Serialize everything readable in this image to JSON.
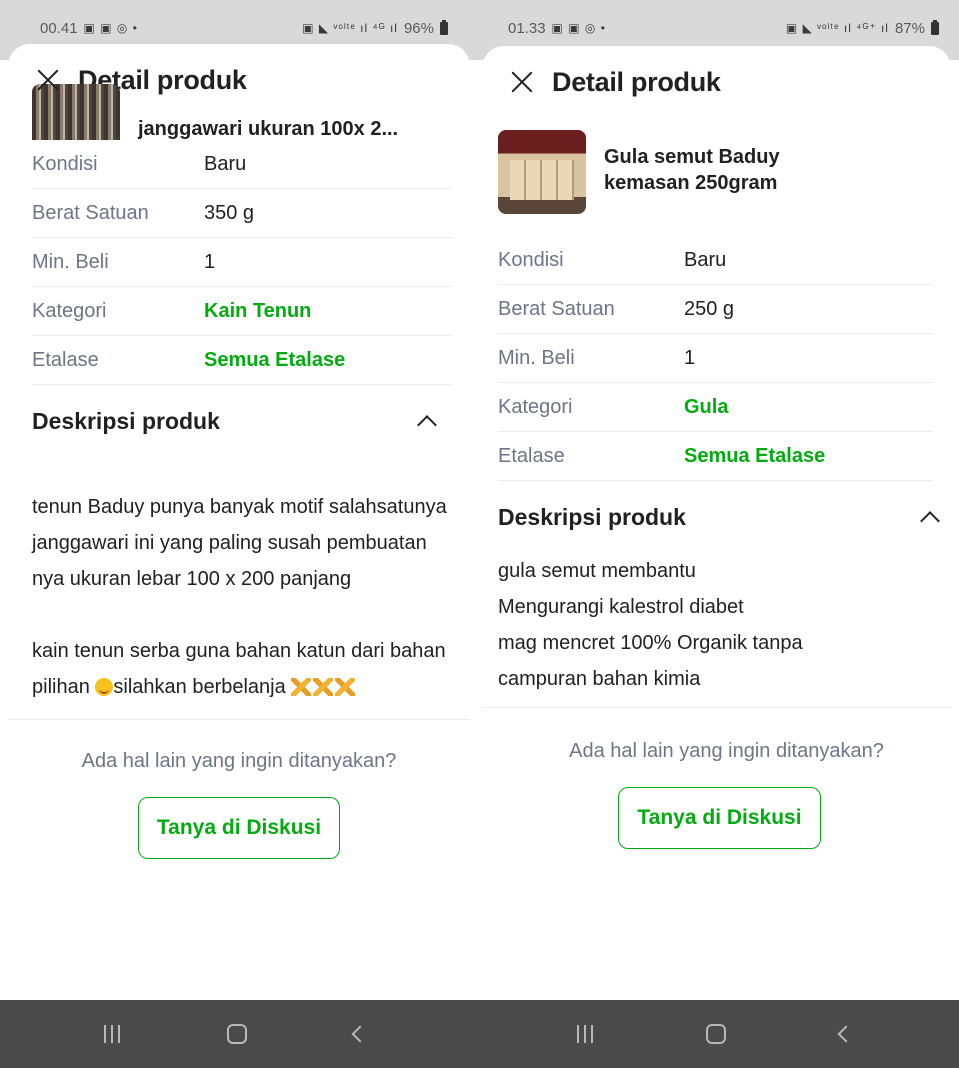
{
  "left": {
    "status": {
      "time": "00.41",
      "icons_left": "▣ ▣ ◎ •",
      "icons_right": "▣ ◣ ᵛᵒˡᵗᵉ ıl ⁴ᴳ ıl",
      "battery": "96%"
    },
    "sheet_title": "Detail produk",
    "product_name": "janggawari ukuran 100x 2...",
    "specs": [
      {
        "label": "Kondisi",
        "value": "Baru"
      },
      {
        "label": "Berat Satuan",
        "value": "350 g"
      },
      {
        "label": "Min. Beli",
        "value": "1"
      },
      {
        "label": "Kategori",
        "value": "Kain Tenun"
      },
      {
        "label": "Etalase",
        "value": "Semua Etalase"
      }
    ],
    "desc_title": "Deskripsi produk",
    "desc_p1": "tenun Baduy punya banyak motif salahsatunya janggawari ini yang paling susah pembuatan nya ukuran lebar 100 x 200 panjang",
    "desc_p2a": "kain tenun serba guna bahan katun dari bahan pilihan ",
    "desc_p2b": "silahkan berbelanja ",
    "ask_text": "Ada hal lain yang ingin ditanyakan?",
    "ask_button": "Tanya di Diskusi"
  },
  "right": {
    "status": {
      "time": "01.33",
      "icons_left": "▣ ▣ ◎ •",
      "icons_right": "▣ ◣ ᵛᵒˡᵗᵉ ıl ⁴ᴳ⁺ ıl",
      "battery": "87%"
    },
    "sheet_title": "Detail produk",
    "product_name": "Gula semut Baduy kemasan 250gram",
    "specs": [
      {
        "label": "Kondisi",
        "value": "Baru"
      },
      {
        "label": "Berat Satuan",
        "value": "250 g"
      },
      {
        "label": "Min. Beli",
        "value": "1"
      },
      {
        "label": "Kategori",
        "value": "Gula"
      },
      {
        "label": "Etalase",
        "value": "Semua Etalase"
      }
    ],
    "desc_title": "Deskripsi produk",
    "desc_lines": [
      "gula semut membantu",
      "Mengurangi kalestrol diabet",
      "mag mencret 100% Organik tanpa",
      "campuran bahan kimia"
    ],
    "ask_text": "Ada hal lain yang ingin ditanyakan?",
    "ask_button": "Tanya di Diskusi"
  },
  "colors": {
    "accent_green": "#03ac0e",
    "label_gray": "#6d7588",
    "navbar": "#4a4a4a"
  },
  "icons": [
    "close-icon",
    "chevron-up-icon",
    "recents-icon",
    "home-icon",
    "back-icon",
    "battery-icon"
  ]
}
